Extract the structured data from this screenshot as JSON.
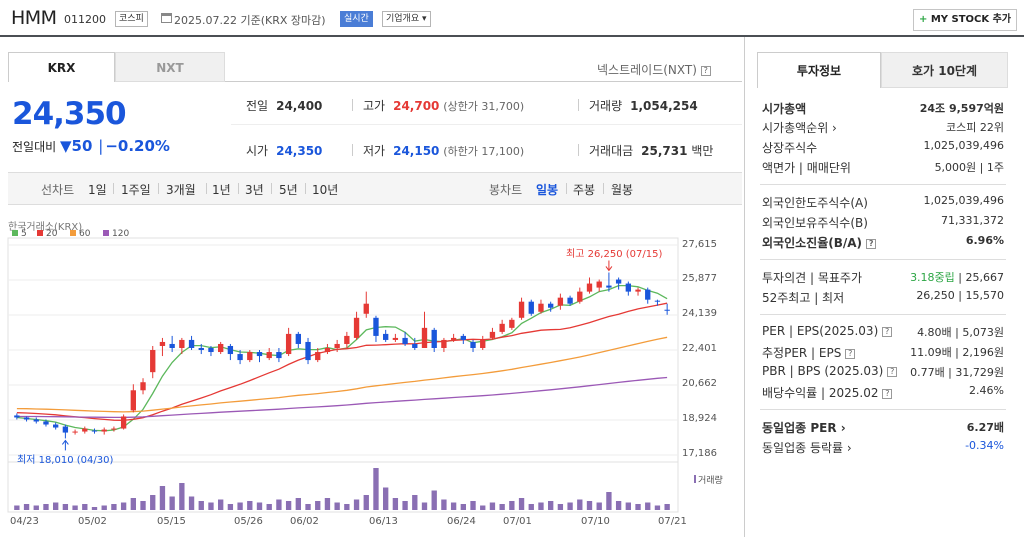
{
  "header": {
    "name": "HMM",
    "code": "011200",
    "market_badge": "코스피",
    "date_text": "2025.07.22  기준(KRX 장마감)",
    "realtime_badge": "실시간",
    "company_badge": "기업개요 ▾",
    "mystock_plus": "+",
    "mystock_label": "MY STOCK 추가"
  },
  "tabs": {
    "krx": "KRX",
    "nxt": "NXT",
    "nxt_link": "넥스트레이드(NXT)"
  },
  "quote": {
    "price": "24,350",
    "change_label": "전일대비",
    "change_arrow": "▼",
    "change_value": "50",
    "change_pct": "−0.20%",
    "prev_label": "전일",
    "prev_value": "24,400",
    "high_label": "고가",
    "high_value": "24,700",
    "upper_limit": "(상한가 31,700)",
    "volume_label": "거래량",
    "volume_value": "1,054,254",
    "open_label": "시가",
    "open_value": "24,350",
    "low_label": "저가",
    "low_value": "24,150",
    "lower_limit": "(하한가 17,100)",
    "amount_label": "거래대금",
    "amount_value": "25,731",
    "amount_unit": "백만"
  },
  "chart_controls": {
    "line_label": "선차트",
    "periods": [
      "1일",
      "1주일",
      "3개월",
      "1년",
      "3년",
      "5년",
      "10년"
    ],
    "candle_label": "봉차트",
    "candle_periods": [
      "일봉",
      "주봉",
      "월봉"
    ]
  },
  "chart_legend": {
    "source": "한국거래소(KRX)",
    "ma": [
      {
        "label": "5",
        "color": "#5cb85c"
      },
      {
        "label": "20",
        "color": "#e53935"
      },
      {
        "label": "60",
        "color": "#f39c3b"
      },
      {
        "label": "120",
        "color": "#9b59b6"
      }
    ],
    "volume_label": "거래량",
    "max_label": "최고 26,250 (07/15)",
    "min_label": "최저 18,010 (04/30)"
  },
  "chart_data": {
    "type": "candlestick",
    "y_ticks": [
      "27,615",
      "25,877",
      "24,139",
      "22,401",
      "20,662",
      "18,924",
      "17,186"
    ],
    "ylim": [
      17186,
      27615
    ],
    "x_ticks": [
      "04/23",
      "05/02",
      "05/15",
      "05/26",
      "06/02",
      "06/13",
      "06/24",
      "07/01",
      "07/10",
      "07/21"
    ],
    "candles": [
      [
        19150,
        19050,
        19250,
        18950
      ],
      [
        19050,
        18950,
        19100,
        18850
      ],
      [
        18950,
        18850,
        19050,
        18750
      ],
      [
        18850,
        18700,
        18950,
        18600
      ],
      [
        18700,
        18550,
        18800,
        18450
      ],
      [
        18600,
        18300,
        18700,
        18010
      ],
      [
        18300,
        18350,
        18450,
        18200
      ],
      [
        18350,
        18500,
        18600,
        18250
      ],
      [
        18400,
        18350,
        18500,
        18250
      ],
      [
        18350,
        18450,
        18550,
        18200
      ],
      [
        18450,
        18500,
        18600,
        18350
      ],
      [
        18500,
        19100,
        19200,
        18450
      ],
      [
        19400,
        20400,
        20700,
        19300
      ],
      [
        20400,
        20800,
        21000,
        20200
      ],
      [
        21300,
        22400,
        22600,
        21000
      ],
      [
        22600,
        22800,
        23000,
        22100
      ],
      [
        22700,
        22500,
        23100,
        22300
      ],
      [
        22500,
        22900,
        23000,
        22200
      ],
      [
        22900,
        22500,
        23100,
        22400
      ],
      [
        22500,
        22400,
        22700,
        22200
      ],
      [
        22500,
        22300,
        22600,
        22100
      ],
      [
        22300,
        22700,
        22800,
        22200
      ],
      [
        22600,
        22200,
        22700,
        21900
      ],
      [
        22200,
        21900,
        22400,
        21700
      ],
      [
        21900,
        22300,
        22400,
        21800
      ],
      [
        22300,
        22100,
        22400,
        21800
      ],
      [
        22000,
        22300,
        22500,
        21900
      ],
      [
        22300,
        22000,
        22500,
        21800
      ],
      [
        22200,
        23200,
        23500,
        22100
      ],
      [
        23200,
        22700,
        23300,
        22500
      ],
      [
        22800,
        21900,
        23000,
        21700
      ],
      [
        21900,
        22300,
        22500,
        21800
      ],
      [
        22300,
        22500,
        22700,
        22200
      ],
      [
        22500,
        22700,
        22900,
        22300
      ],
      [
        22700,
        23100,
        23300,
        22500
      ],
      [
        23000,
        24000,
        24300,
        22900
      ],
      [
        24200,
        24700,
        25300,
        24000
      ],
      [
        24000,
        23100,
        24100,
        22800
      ],
      [
        23200,
        22900,
        23400,
        22800
      ],
      [
        22900,
        23000,
        23200,
        22800
      ],
      [
        23000,
        22700,
        23300,
        22600
      ],
      [
        22700,
        22500,
        23000,
        22400
      ],
      [
        22500,
        23500,
        24300,
        22500
      ],
      [
        23400,
        22500,
        23500,
        22300
      ],
      [
        22500,
        22900,
        23000,
        22300
      ],
      [
        22900,
        23000,
        23200,
        22800
      ],
      [
        23100,
        22900,
        23200,
        22700
      ],
      [
        22800,
        22500,
        22900,
        22300
      ],
      [
        22500,
        22900,
        23100,
        22400
      ],
      [
        23000,
        23300,
        23500,
        22900
      ],
      [
        23300,
        23700,
        23900,
        23200
      ],
      [
        23500,
        23900,
        24000,
        23400
      ],
      [
        24000,
        24800,
        25000,
        23900
      ],
      [
        24800,
        24200,
        24900,
        24100
      ],
      [
        24300,
        24700,
        24900,
        24200
      ],
      [
        24700,
        24500,
        24800,
        24300
      ],
      [
        24600,
        25000,
        25200,
        24400
      ],
      [
        25000,
        24700,
        25100,
        24600
      ],
      [
        24800,
        25300,
        25500,
        24700
      ],
      [
        25300,
        25700,
        26000,
        25200
      ],
      [
        25500,
        25800,
        25900,
        25300
      ],
      [
        25600,
        25500,
        26250,
        25300
      ],
      [
        25900,
        25700,
        26000,
        25400
      ],
      [
        25700,
        25300,
        25800,
        25100
      ],
      [
        25300,
        25400,
        25500,
        25100
      ],
      [
        25400,
        24900,
        25500,
        24700
      ],
      [
        24850,
        24800,
        24900,
        24600
      ],
      [
        24400,
        24350,
        24700,
        24150
      ]
    ],
    "volume_index": [
      3,
      4,
      3,
      4,
      5,
      4,
      3,
      4,
      2,
      3,
      4,
      5,
      8,
      6,
      10,
      16,
      9,
      18,
      9,
      6,
      5,
      7,
      4,
      5,
      6,
      5,
      4,
      7,
      6,
      8,
      4,
      6,
      8,
      5,
      4,
      7,
      10,
      28,
      15,
      8,
      6,
      10,
      5,
      13,
      7,
      5,
      4,
      6,
      3,
      5,
      4,
      6,
      8,
      4,
      5,
      6,
      4,
      5,
      7,
      6,
      5,
      12,
      6,
      5,
      4,
      5,
      3,
      4
    ]
  },
  "right": {
    "tabs": [
      "투자정보",
      "호가 10단계"
    ],
    "market_cap_label": "시가총액",
    "market_cap_value": "24조 9,597억원",
    "rank_label": "시가총액순위 ›",
    "rank_value": "코스피 22위",
    "shares_label": "상장주식수",
    "shares_value": "1,025,039,496",
    "face_label": "액면가 | 매매단위",
    "face_value": "5,000원 | 1주",
    "foreign_limit_label": "외국인한도주식수(A)",
    "foreign_limit_value": "1,025,039,496",
    "foreign_hold_label": "외국인보유주식수(B)",
    "foreign_hold_value": "71,331,372",
    "foreign_ratio_label": "외국인소진율(B/A)",
    "foreign_ratio_value": "6.96%",
    "opinion_label": "투자의견 | 목표주가",
    "opinion_value": "3.18중립",
    "target_value": "| 25,667",
    "w52_label": "52주최고 | 최저",
    "w52_value": "26,250 | 15,570",
    "per_label": "PER | EPS(2025.03)",
    "per_value": "4.80배 | 5,073원",
    "est_per_label": "추정PER | EPS",
    "est_per_value": "11.09배 | 2,196원",
    "pbr_label": "PBR | BPS (2025.03)",
    "pbr_value": "0.77배 | 31,729원",
    "div_label": "배당수익률 | 2025.02",
    "div_value": "2.46%",
    "sector_per_label": "동일업종 PER ›",
    "sector_per_value": "6.27배",
    "sector_rate_label": "동일업종 등락률 ›",
    "sector_rate_value": "-0.34%"
  }
}
